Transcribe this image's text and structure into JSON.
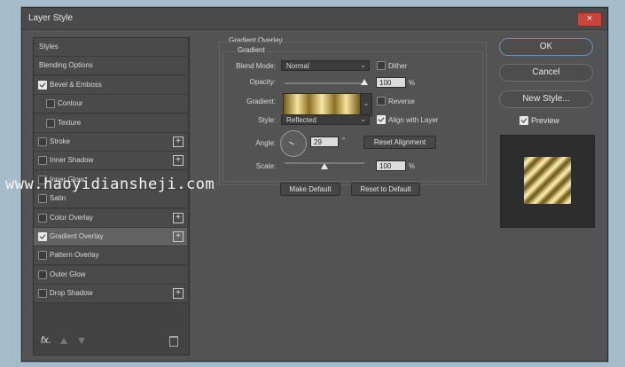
{
  "window": {
    "title": "Layer Style",
    "close_icon": "×"
  },
  "sidebar": {
    "items": [
      {
        "label": "Styles",
        "checkbox": false,
        "checked": false,
        "plus": false,
        "indent": false
      },
      {
        "label": "Blending Options",
        "checkbox": false,
        "checked": false,
        "plus": false,
        "indent": false
      },
      {
        "label": "Bevel & Emboss",
        "checkbox": true,
        "checked": true,
        "plus": false,
        "indent": false
      },
      {
        "label": "Contour",
        "checkbox": true,
        "checked": false,
        "plus": false,
        "indent": true
      },
      {
        "label": "Texture",
        "checkbox": true,
        "checked": false,
        "plus": false,
        "indent": true
      },
      {
        "label": "Stroke",
        "checkbox": true,
        "checked": false,
        "plus": true,
        "indent": false
      },
      {
        "label": "Inner Shadow",
        "checkbox": true,
        "checked": false,
        "plus": true,
        "indent": false
      },
      {
        "label": "Inner Glow",
        "checkbox": true,
        "checked": false,
        "plus": false,
        "indent": false
      },
      {
        "label": "Satin",
        "checkbox": true,
        "checked": false,
        "plus": false,
        "indent": false
      },
      {
        "label": "Color Overlay",
        "checkbox": true,
        "checked": false,
        "plus": true,
        "indent": false
      },
      {
        "label": "Gradient Overlay",
        "checkbox": true,
        "checked": true,
        "plus": true,
        "indent": false,
        "active": true
      },
      {
        "label": "Pattern Overlay",
        "checkbox": true,
        "checked": false,
        "plus": false,
        "indent": false
      },
      {
        "label": "Outer Glow",
        "checkbox": true,
        "checked": false,
        "plus": false,
        "indent": false
      },
      {
        "label": "Drop Shadow",
        "checkbox": true,
        "checked": false,
        "plus": true,
        "indent": false
      }
    ],
    "footer": {
      "fx_label": "fx",
      "fx_sub": "."
    }
  },
  "gradient_overlay": {
    "section_title": "Gradient Overlay",
    "subsection_title": "Gradient",
    "blend_mode_label": "Blend Mode:",
    "blend_mode_value": "Normal",
    "dither_label": "Dither",
    "dither_checked": false,
    "opacity_label": "Opacity:",
    "opacity_value": "100",
    "opacity_unit": "%",
    "opacity_level": 1.0,
    "gradient_label": "Gradient:",
    "reverse_label": "Reverse",
    "reverse_checked": false,
    "style_label": "Style:",
    "style_value": "Reflected",
    "align_label": "Align with Layer",
    "align_checked": true,
    "angle_label": "Angle:",
    "angle_value": "29",
    "angle_unit": "°",
    "reset_alignment_label": "Reset Alignment",
    "scale_label": "Scale:",
    "scale_value": "100",
    "scale_unit": "%",
    "scale_level": 0.5,
    "make_default_label": "Make Default",
    "reset_default_label": "Reset to Default"
  },
  "actions": {
    "ok_label": "OK",
    "cancel_label": "Cancel",
    "new_style_label": "New Style...",
    "preview_label": "Preview",
    "preview_checked": true
  },
  "watermark": "www.haoyidiansheji.com",
  "colors": {
    "dialog_bg": "#535353",
    "accent_border": "#6d8fb3",
    "close_red": "#c8453c",
    "gold_light": "#f5e39b",
    "gold_dark": "#6f5a1c"
  }
}
